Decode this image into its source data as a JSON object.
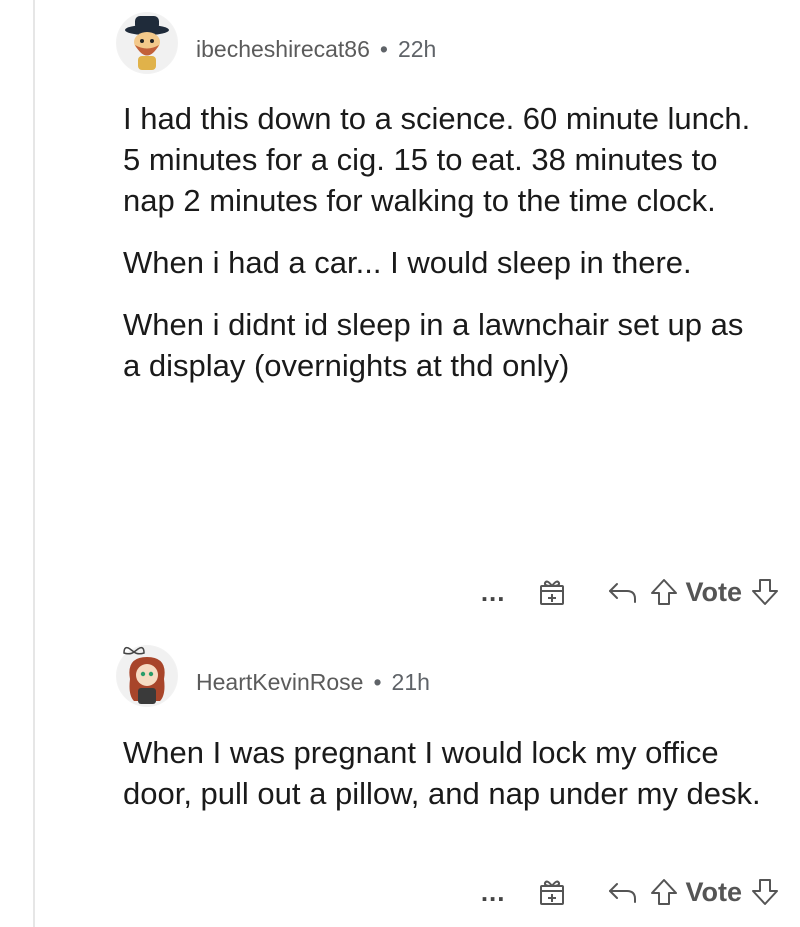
{
  "comments": [
    {
      "username": "ibecheshirecat86",
      "separator": "•",
      "age": "22h",
      "paragraphs": [
        "I had this down to a science. 60 minute lunch.  5 minutes for a cig. 15 to eat. 38 minutes to nap 2 minutes for walking to the time clock.",
        "When i had a car... I would sleep in there.",
        "When i didnt id sleep in a lawnchair set up as a display (overnights at thd only)"
      ],
      "more_label": "...",
      "vote_label": "Vote"
    },
    {
      "username": "HeartKevinRose",
      "separator": "•",
      "age": "21h",
      "paragraphs": [
        "When I was pregnant I would lock my office door, pull out a pillow, and nap under my desk."
      ],
      "more_label": "...",
      "vote_label": "Vote"
    }
  ],
  "icons": [
    "more-options-icon",
    "award-icon",
    "reply-icon",
    "upvote-icon",
    "downvote-icon"
  ],
  "colors": {
    "text": "#1a1a1a",
    "meta": "#5f6368",
    "thread_line": "#e6e6e6"
  }
}
